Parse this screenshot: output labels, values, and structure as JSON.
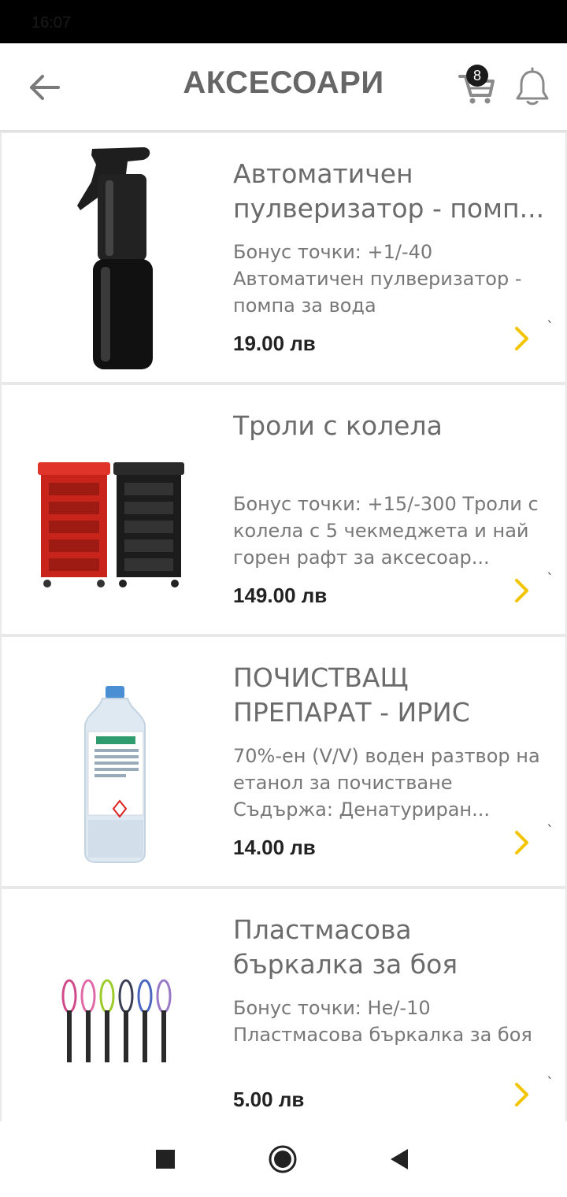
{
  "status_bar": {
    "time": "16:07",
    "icons": ""
  },
  "header": {
    "title": "АКСЕСОАРИ",
    "cart_count": "8"
  },
  "products": [
    {
      "name": "Автоматичен пулверизатор - помп...",
      "description": "Бонус точки: +1/-40 Автоматичен пулверизатор - помпа за вода",
      "price": "19.00 лв",
      "image": "spray-bottle"
    },
    {
      "name": "Троли с колела",
      "description": "Бонус точки: +15/-300   Троли с колела с 5 чекмеджета и най горен рафт за аксесоар...",
      "price": "149.00 лв",
      "image": "trolley-carts"
    },
    {
      "name": "ПОЧИСТВАЩ ПРЕПАРАТ - ИРИС",
      "description": "70%-ен (V/V) воден разтвор на етанол за почистване Съдържа: Денатуриран...",
      "price": "14.00 лв",
      "image": "cleaner-bottle"
    },
    {
      "name": "Пластмасова бъркалка за боя",
      "description": "Бонус точки: Не/-10 Пластмасова бъркалка за боя",
      "price": "5.00 лв",
      "image": "plastic-whisks"
    }
  ],
  "colors": {
    "accent": "#f3c400",
    "title": "#666666",
    "price": "#222222"
  }
}
